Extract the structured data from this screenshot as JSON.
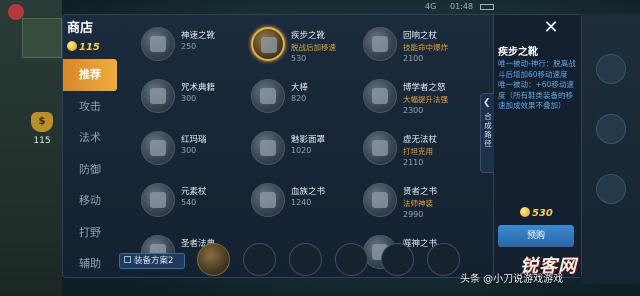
{
  "status_bar": {
    "signal": "4G",
    "clock": "01:48"
  },
  "hud": {
    "gold": "115"
  },
  "shop": {
    "title": "商店",
    "balance": "115",
    "tabs": [
      {
        "label": "推荐",
        "active": true
      },
      {
        "label": "攻击",
        "active": false
      },
      {
        "label": "法术",
        "active": false
      },
      {
        "label": "防御",
        "active": false
      },
      {
        "label": "移动",
        "active": false
      },
      {
        "label": "打野",
        "active": false
      },
      {
        "label": "辅助",
        "active": false
      }
    ],
    "items": [
      {
        "name": "神速之靴",
        "sub": "",
        "price": "250",
        "icon": "boots-icon",
        "selected": false
      },
      {
        "name": "疾步之靴",
        "sub": "脱战后加移速",
        "price": "530",
        "icon": "swift-boots-icon",
        "selected": true
      },
      {
        "name": "回响之杖",
        "sub": "技能命中爆炸",
        "price": "2100",
        "icon": "echo-staff-icon",
        "selected": false
      },
      {
        "name": "咒术典籍",
        "sub": "",
        "price": "300",
        "icon": "spellbook-icon",
        "selected": false
      },
      {
        "name": "大棒",
        "sub": "",
        "price": "820",
        "icon": "club-icon",
        "selected": false
      },
      {
        "name": "博学者之怒",
        "sub": "大幅提升法强",
        "price": "2300",
        "icon": "scholar-rage-icon",
        "selected": false
      },
      {
        "name": "红玛瑙",
        "sub": "",
        "price": "300",
        "icon": "red-agate-icon",
        "selected": false
      },
      {
        "name": "魅影面罩",
        "sub": "",
        "price": "1020",
        "icon": "phantom-mask-icon",
        "selected": false
      },
      {
        "name": "虚无法杖",
        "sub": "打坦克用",
        "price": "2110",
        "icon": "void-staff-icon",
        "selected": false
      },
      {
        "name": "元素杖",
        "sub": "",
        "price": "540",
        "icon": "element-staff-icon",
        "selected": false
      },
      {
        "name": "血族之书",
        "sub": "",
        "price": "1240",
        "icon": "blood-book-icon",
        "selected": false
      },
      {
        "name": "贤者之书",
        "sub": "法师神装",
        "price": "2990",
        "icon": "sage-book-icon",
        "selected": false
      },
      {
        "name": "圣者法典",
        "sub": "",
        "price": "",
        "icon": "holy-codex-icon",
        "selected": false
      },
      {
        "name": "",
        "sub": "",
        "price": "",
        "icon": "",
        "selected": false
      },
      {
        "name": "噬神之书",
        "sub": "",
        "price": "",
        "icon": "devour-book-icon",
        "selected": false
      }
    ],
    "plan_label": "装备方案2",
    "detail": {
      "title": "疾步之靴",
      "desc": [
        "唯一被动-神行：脱离战斗后增加60移动速度",
        "唯一被动：+60移动速度（所有鞋类装备的移速加成效果不叠加）"
      ],
      "price": "530",
      "buy_label": "预购",
      "collapse_label": "合成路径"
    }
  },
  "watermark": {
    "brand": "锐客网",
    "line": "头条 @小刀说游戏游戏"
  },
  "colors": {
    "accent": "#f0ac3f",
    "gold": "#f6cf56",
    "desc_blue": "#5fa7e8",
    "buy": "#3b8ad2"
  }
}
